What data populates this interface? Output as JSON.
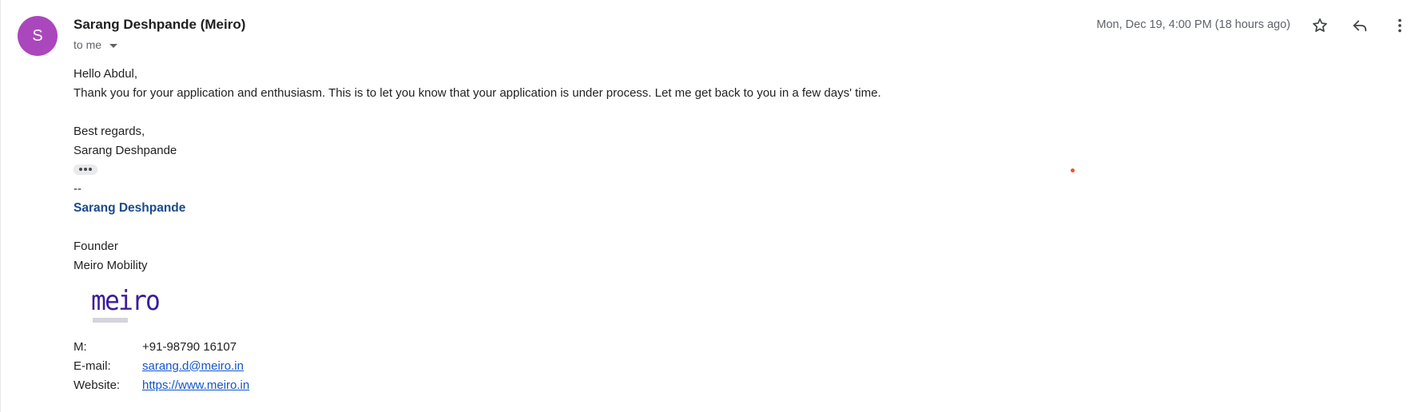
{
  "email": {
    "avatar_letter": "S",
    "avatar_color": "#ab47bc",
    "sender": "Sarang Deshpande (Meiro)",
    "to_label": "to me",
    "date": "Mon, Dec 19, 4:00 PM (18 hours ago)",
    "actions": {
      "star_icon": "star-outline-icon",
      "reply_icon": "reply-icon",
      "more_icon": "more-vertical-icon"
    },
    "body": {
      "greeting": "Hello Abdul,",
      "message": "Thank you for your application and enthusiasm. This is to let you know that your application is under process. Let me get back to you in a few days' time.",
      "closing": "Best regards,",
      "closing_name": "Sarang Deshpande"
    },
    "signature": {
      "dash": "--",
      "name": "Sarang Deshpande",
      "title": "Founder",
      "company": "Meiro Mobility",
      "logo_text": "meiro",
      "logo_color": "#3d1d9a",
      "mobile_label": "M:",
      "mobile_value": "+91-98790 16107",
      "email_label": "E-mail:",
      "email_value": "sarang.d@meiro.in",
      "website_label": "Website:",
      "website_value": "https://www.meiro.in"
    }
  }
}
